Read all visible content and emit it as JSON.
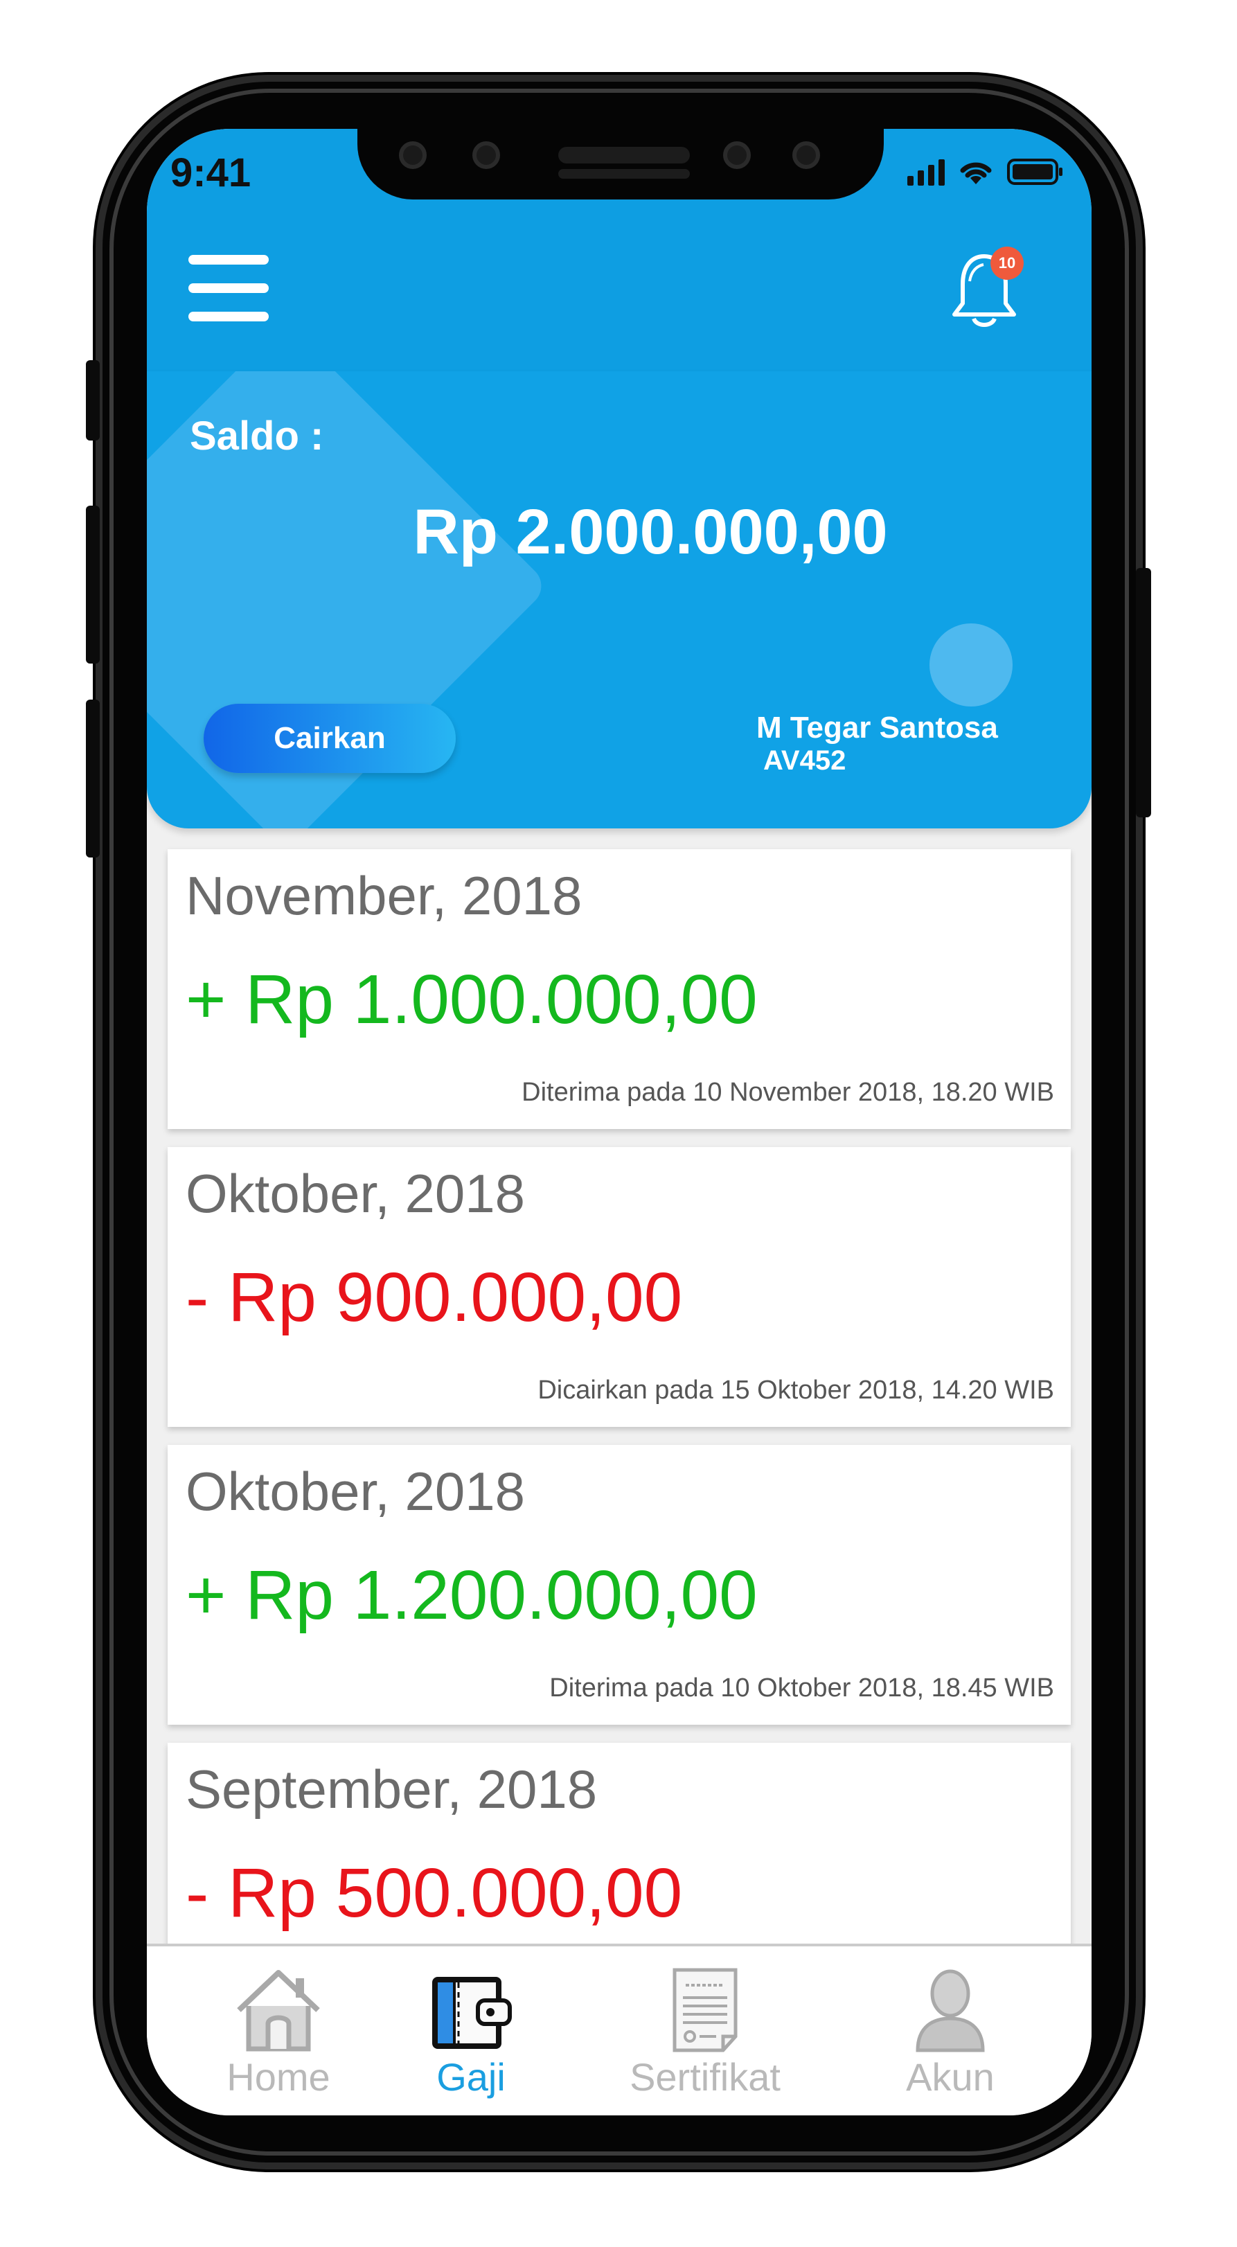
{
  "status_bar": {
    "time": "9:41"
  },
  "header": {
    "menu_icon": "hamburger-menu-icon",
    "notification_icon": "bell-icon",
    "notification_count": "10"
  },
  "balance": {
    "label": "Saldo :",
    "amount": "Rp 2.000.000,00",
    "button_label": "Cairkan",
    "user_name": "M Tegar Santosa",
    "user_id": "AV452"
  },
  "transactions": [
    {
      "month": "November, 2018",
      "amount": "+ Rp 1.000.000,00",
      "type": "credit",
      "note": "Diterima pada 10 November 2018, 18.20 WIB"
    },
    {
      "month": "Oktober, 2018",
      "amount": "- Rp 900.000,00",
      "type": "debit",
      "note": "Dicairkan pada 15 Oktober 2018, 14.20 WIB"
    },
    {
      "month": "Oktober, 2018",
      "amount": "+ Rp 1.200.000,00",
      "type": "credit",
      "note": "Diterima pada 10 Oktober 2018, 18.45 WIB"
    },
    {
      "month": "September, 2018",
      "amount": "- Rp 500.000,00",
      "type": "debit",
      "note": ""
    }
  ],
  "bottom_nav": [
    {
      "label": "Home",
      "icon": "home-icon",
      "active": false
    },
    {
      "label": "Gaji",
      "icon": "wallet-icon",
      "active": true
    },
    {
      "label": "Sertifikat",
      "icon": "certificate-icon",
      "active": false
    },
    {
      "label": "Akun",
      "icon": "user-icon",
      "active": false
    }
  ],
  "colors": {
    "primary": "#0e9ee2",
    "credit": "#14b81e",
    "debit": "#e8141b",
    "nav_active": "#1a9ee0",
    "nav_inactive": "#b9b9b9",
    "badge": "#ef5a3c"
  }
}
